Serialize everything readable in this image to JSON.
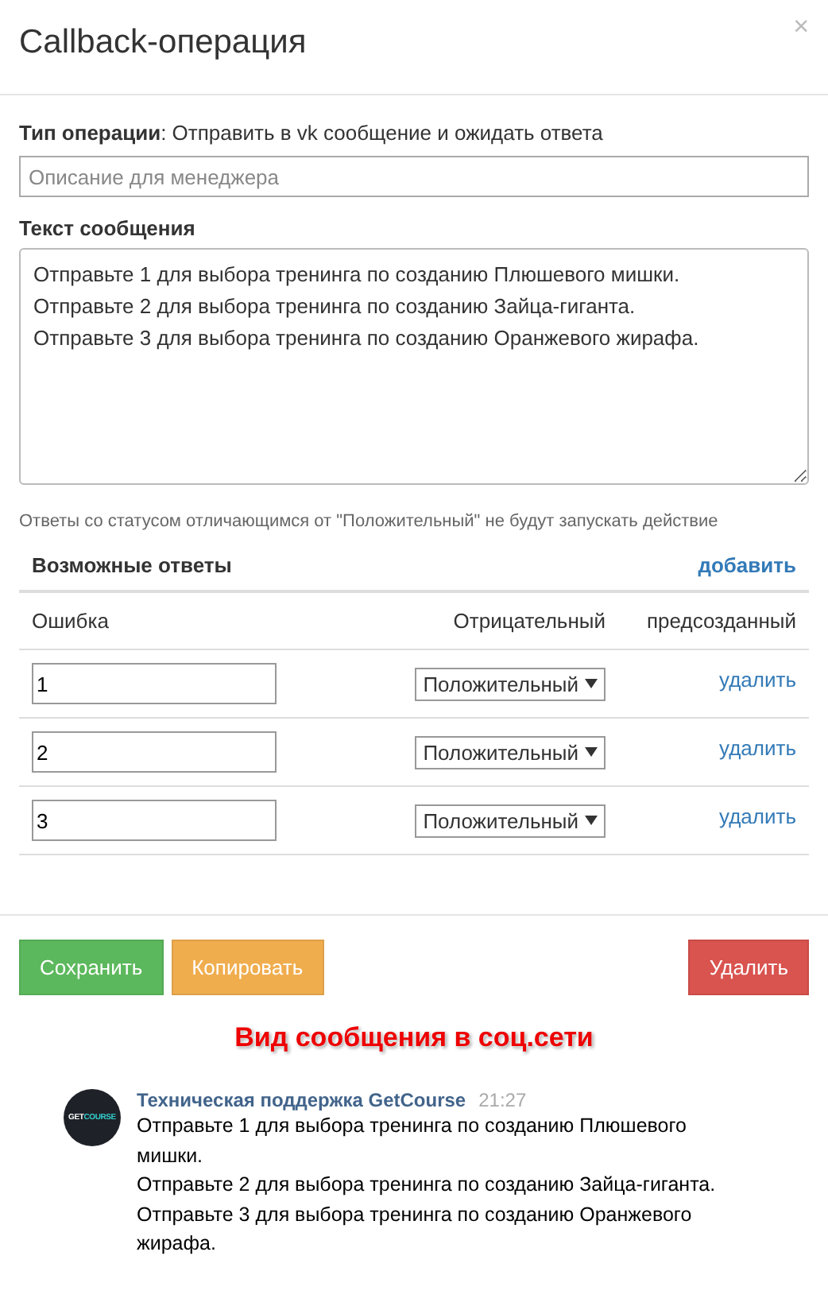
{
  "modal": {
    "title": "Callback-операция",
    "close": "×"
  },
  "operation_type": "**Тип операции**: Отправить в vk сообщение и ожидать ответа",
  "description_field": {
    "placeholder": "Описание для менеджера"
  },
  "message": {
    "label": "Текст сообщения",
    "lines": [
      "Отправьте 1 для выбора тренинга по созданию Плюшевого мишки.",
      "Отправьте 2 для выбора тренинга по созданию Зайца-гиганта.",
      "Отправьте 3 для выбора тренинга по созданию Оранжевого жирафа."
    ]
  },
  "hint": "Ответы со статусом отличающимся от \"Положительный\" не будут запускать действие",
  "answers": {
    "title": "Возможные ответы",
    "add_link": "добавить",
    "columns": [
      "Ошибка",
      "Отрицательный",
      "предсозданный"
    ],
    "rows": [
      {
        "value": "1",
        "status": "Положительный",
        "delete": "удалить"
      },
      {
        "value": "2",
        "status": "Положительный",
        "delete": "удалить"
      },
      {
        "value": "3",
        "status": "Положительный",
        "delete": "удалить"
      }
    ]
  },
  "buttons": [
    {
      "label": "Сохранить",
      "kind": "success"
    },
    {
      "label": "Копировать",
      "kind": "warning"
    },
    {
      "label": "Удалить",
      "kind": "danger"
    }
  ],
  "preview": {
    "caption": "Вид сообщения в соц.сети",
    "logo": {
      "part_1": "GET",
      "part_2": "COURSE"
    },
    "sender": "Техническая поддержка GetCourse",
    "time": "21:27",
    "lines": [
      "Отправьте 1 для выбора тренинга по созданию Плюшевого мишки.",
      "Отправьте 2 для выбора тренинга по созданию Зайца-гиганта.",
      "Отправьте 3 для выбора тренинга по созданию Оранжевого жирафа."
    ]
  }
}
